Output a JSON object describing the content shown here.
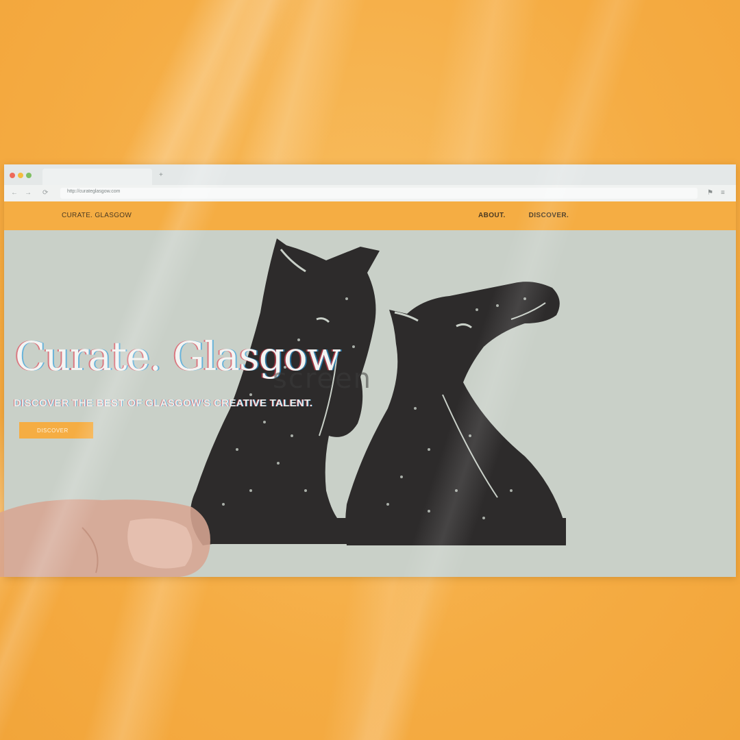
{
  "browser": {
    "url": "http://curateglasgow.com",
    "back_glyph": "←",
    "forward_glyph": "→",
    "reload_glyph": "⟳",
    "newtab_glyph": "+",
    "extensions_glyph": "⚑",
    "menu_glyph": "≡"
  },
  "header": {
    "brand": "CURATE. GLASGOW",
    "nav": [
      "ABOUT.",
      "DISCOVER."
    ]
  },
  "hero": {
    "title": "Curate. Glasgow",
    "overlay_text": "screen",
    "subtitle": "DISCOVER THE BEST OF GLASGOW'S CREATIVE TALENT.",
    "button_label": "DISCOVER"
  },
  "colors": {
    "accent": "#f5ad43",
    "hero_bg": "#c9d0c8",
    "ink": "#2d2b2b",
    "background": "#f6b24d"
  },
  "icons": [
    "arrow-left-icon",
    "arrow-right-icon",
    "reload-icon",
    "site-favicon",
    "plus-icon",
    "extension-icon",
    "menu-icon"
  ]
}
